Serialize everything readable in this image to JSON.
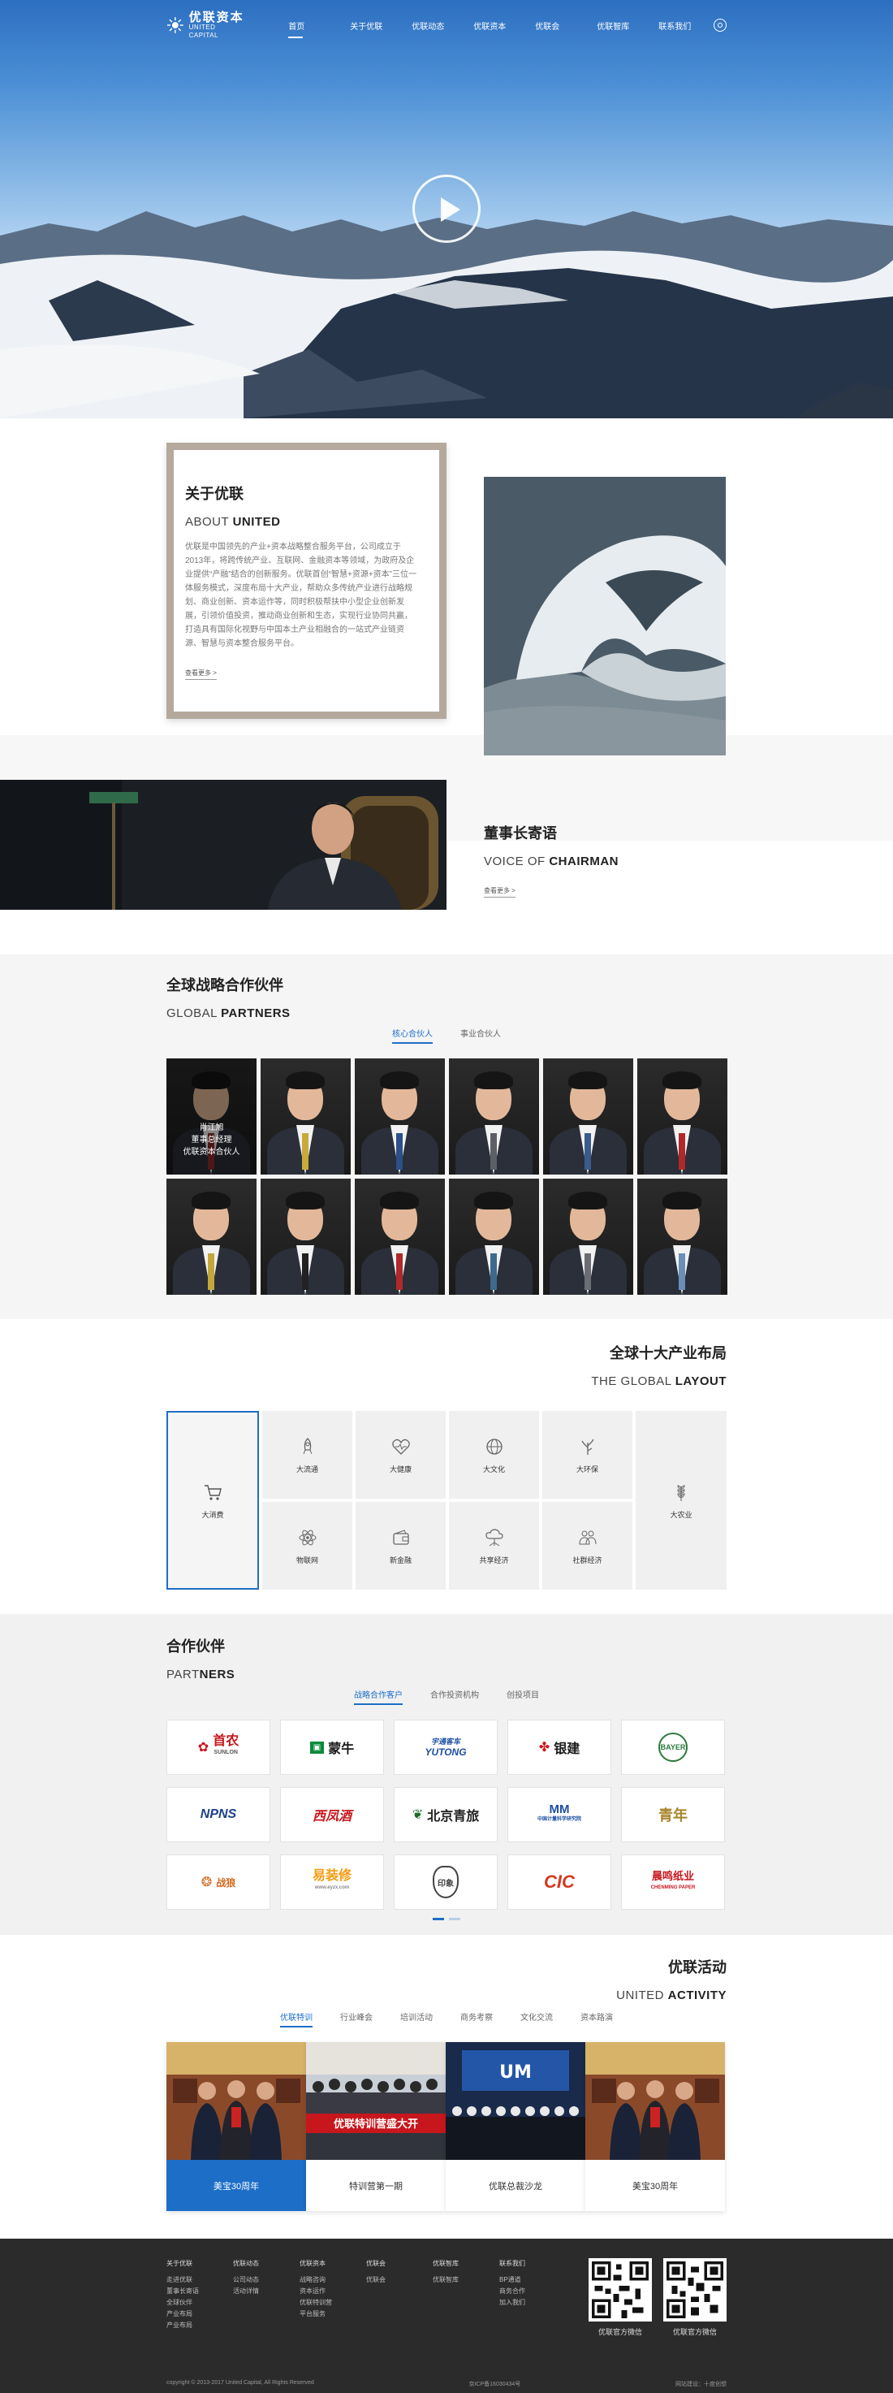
{
  "nav": {
    "logo_cn": "优联资本",
    "logo_en": "UNITED CAPITAL",
    "items": [
      "首页",
      "关于优联",
      "优联动态",
      "优联资本",
      "优联会",
      "优联智库",
      "联系我们"
    ]
  },
  "about": {
    "title_cn": "关于优联",
    "title_en_1": "ABOUT ",
    "title_en_2": "UNITED",
    "text": "优联是中国领先的产业+资本战略整合服务平台，公司成立于2013年，将跨传统产业、互联网、金融资本等领域，为政府及企业提供“产融”结合的创新服务。优联首创“智慧+资源+资本”三位一体服务模式，深度布局十大产业，帮助众多传统产业进行战略规划、商业创新、资本运作等，同时积极帮扶中小型企业创新发展，引领价值投资，推动商业创新和生态，实现行业协同共赢，打造具有国际化视野与中国本土产业相融合的一站式产业链资源、智慧与资本整合服务平台。",
    "more": "查看更多 >"
  },
  "chairman": {
    "title_cn": "董事长寄语",
    "title_en_1": "VOICE OF ",
    "title_en_2": "CHAIRMAN",
    "more": "查看更多 >"
  },
  "global_partners": {
    "title_cn": "全球战略合作伙伴",
    "title_en_1": "GLOBAL ",
    "title_en_2": "PARTNERS",
    "tabs": [
      "核心合伙人",
      "事业合伙人"
    ],
    "overlay_line1": "肖江旭",
    "overlay_line2": "董事总经理",
    "overlay_line3": "优联资本合伙人"
  },
  "layout": {
    "title_cn": "全球十大产业布局",
    "title_en_1": "THE GLOBAL ",
    "title_en_2": "LAYOUT",
    "industries": [
      "大消费",
      "大流通",
      "大健康",
      "大文化",
      "大环保",
      "大农业",
      "物联网",
      "新金融",
      "共享经济",
      "社群经济"
    ]
  },
  "partners": {
    "title_cn": "合作伙伴",
    "title_en_1": "PART",
    "title_en_2": "NERS",
    "tabs": [
      "战略合作客户",
      "合作投资机构",
      "创投项目"
    ],
    "logos": [
      "首农",
      "蒙牛",
      "宇通客车",
      "银建",
      "BAYER",
      "NPNS",
      "西凤酒",
      "北京青旅",
      "MM",
      "青年",
      "战狼",
      "易装修",
      "印象",
      "CIC",
      "晨鸣纸业"
    ],
    "logo_subs": [
      "SUNLON",
      "",
      "YUTONG",
      "",
      "",
      "",
      "",
      "",
      "中国计量科学研究院",
      "",
      "",
      "www.eyzx.com",
      "",
      "",
      "CHENMING PAPER"
    ]
  },
  "activity": {
    "title_cn": "优联活动",
    "title_en_1": "UNITED ",
    "title_en_2": "ACTIVITY",
    "tabs": [
      "优联特训",
      "行业峰会",
      "培训活动",
      "商务考察",
      "文化交流",
      "资本路演"
    ],
    "cards": [
      "美宝30周年",
      "特训营第一期",
      "优联总裁沙龙",
      "美宝30周年"
    ],
    "banner": "优联特训营盛大开"
  },
  "footer": {
    "cols": [
      {
        "h": "关于优联",
        "items": [
          "走进优联",
          "董事长寄语",
          "全球伙伴",
          "产业布局",
          "产业布局"
        ]
      },
      {
        "h": "优联动态",
        "items": [
          "公司动态",
          "活动详情"
        ]
      },
      {
        "h": "优联资本",
        "items": [
          "战略咨询",
          "资本运作",
          "优联特训营",
          "平台服务"
        ]
      },
      {
        "h": "优联会",
        "items": [
          "优联会"
        ]
      },
      {
        "h": "优联智库",
        "items": [
          "优联智库"
        ]
      },
      {
        "h": "联系我们",
        "items": [
          "BP通道",
          "商务合作",
          "加入我们"
        ]
      }
    ],
    "qr1": "优联官方微信",
    "qr2": "优联官方微信",
    "copyright": "copyright © 2013-2017 United Capital, All Rights Reserved",
    "icp": "京ICP备16030434号",
    "builder": "网站建设：十度创想"
  },
  "colors": {
    "accent": "#1d6ec7",
    "footer": "#2b2b2b",
    "frame": "#b5a99d"
  }
}
